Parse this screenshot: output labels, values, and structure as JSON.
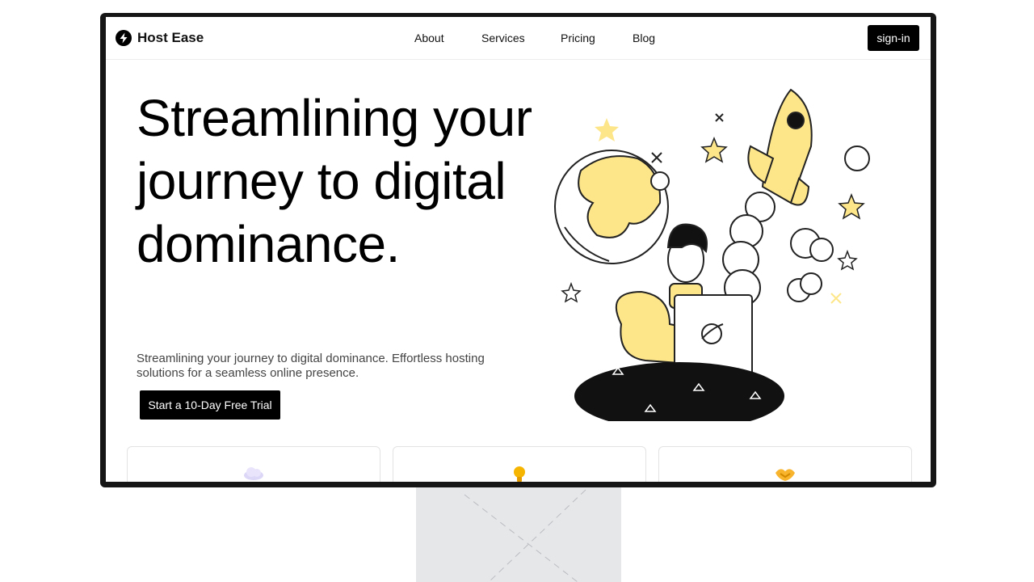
{
  "brand": {
    "name": "Host Ease",
    "icon": "lightning-bolt-icon"
  },
  "nav": {
    "links": [
      "About",
      "Services",
      "Pricing",
      "Blog"
    ],
    "signin_label": "sign-in"
  },
  "hero": {
    "title": "Streamlining your journey to digital dominance.",
    "subtitle": "Streamlining your journey to digital dominance. Effortless hosting solutions for a seamless online presence.",
    "cta_label": "Start a 10-Day Free Trial",
    "illustration": "rocket-launch-illustration"
  },
  "features": {
    "cards": [
      {
        "icon": "cloud-icon"
      },
      {
        "icon": "lightbulb-icon"
      },
      {
        "icon": "handshake-icon"
      }
    ]
  },
  "colors": {
    "accent": "#fde68a",
    "dark": "#000000",
    "frame": "#161616"
  }
}
